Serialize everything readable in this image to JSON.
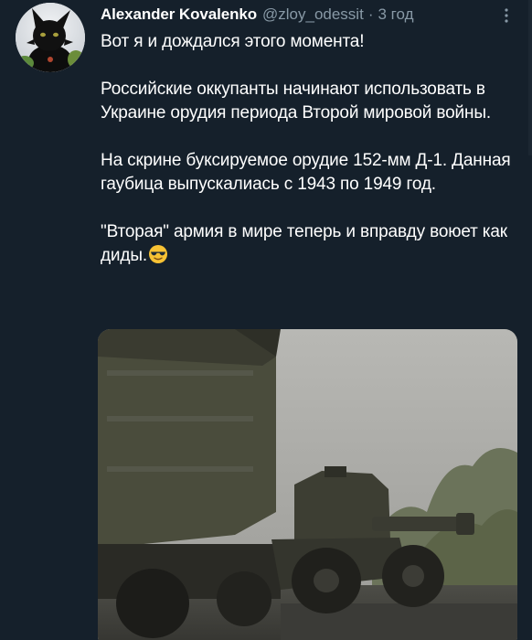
{
  "tweet": {
    "author": {
      "display_name": "Alexander Kovalenko",
      "handle": "@zloy_odessit",
      "avatar_icon": "black-cat-avatar"
    },
    "separator": "·",
    "time": "3 год",
    "more_icon": "more-vertical-icon",
    "paragraphs": {
      "p1": "Вот я и дождался этого момента!",
      "p2": "Российские оккупанты начинают использовать в Украине орудия периода Второй мировой войны.",
      "p3": "На скрине буксируемое орудие 152-мм Д-1. Данная гаубица выпускалиась с 1943 по 1949 год.",
      "p4": "\"Вторая\" армия в мире теперь и вправду воюет как диды."
    },
    "emoji": "smiling-face-with-sunglasses",
    "media": {
      "type": "photo",
      "icon": "photo-military-truck-towing-howitzer"
    }
  },
  "colors": {
    "background": "#15202b",
    "primary_text": "#ffffff",
    "secondary_text": "#8899a6"
  }
}
